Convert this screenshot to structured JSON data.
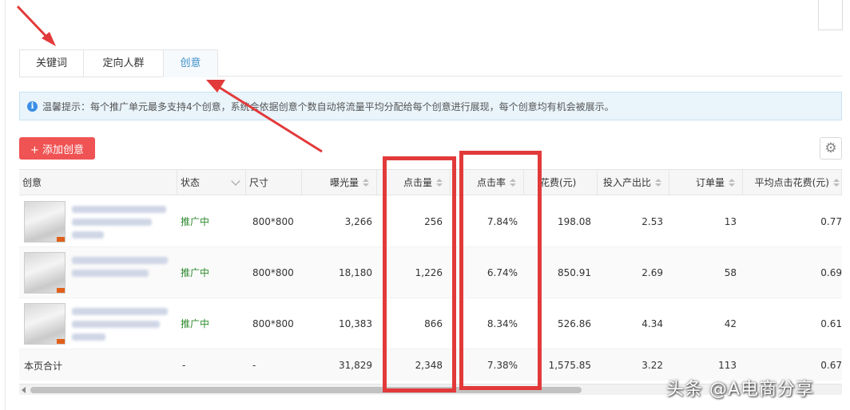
{
  "tabs": [
    {
      "label": "关键词"
    },
    {
      "label": "定向人群"
    },
    {
      "label": "创意"
    }
  ],
  "notice": {
    "icon": "info-icon",
    "text": "温馨提示：每个推广单元最多支持4个创意，系统会依据创意个数自动将流量平均分配给每个创意进行展现，每个创意均有机会被展示。"
  },
  "toolbar": {
    "add_label": "+ 添加创意",
    "settings_icon": "gear-icon"
  },
  "table": {
    "headers": [
      "创意",
      "状态",
      "尺寸",
      "曝光量",
      "点击量",
      "点击率",
      "花费(元)",
      "投入产出比",
      "订单量",
      "平均点击花费(元)"
    ],
    "rows": [
      {
        "status": "推广中",
        "size": "800*800",
        "impressions": "3,266",
        "clicks": "256",
        "ctr": "7.84%",
        "cost": "198.08",
        "roi": "2.53",
        "orders": "13",
        "avg_cpc": "0.77"
      },
      {
        "status": "推广中",
        "size": "800*800",
        "impressions": "18,180",
        "clicks": "1,226",
        "ctr": "6.74%",
        "cost": "850.91",
        "roi": "2.69",
        "orders": "58",
        "avg_cpc": "0.69"
      },
      {
        "status": "推广中",
        "size": "800*800",
        "impressions": "10,383",
        "clicks": "866",
        "ctr": "8.34%",
        "cost": "526.86",
        "roi": "4.34",
        "orders": "42",
        "avg_cpc": "0.61"
      }
    ],
    "summary": {
      "label": "本页合计",
      "status": "-",
      "size": "-",
      "impressions": "31,829",
      "clicks": "2,348",
      "ctr": "7.38%",
      "cost": "1,575.85",
      "roi": "3.22",
      "orders": "113",
      "avg_cpc": "0.67"
    }
  },
  "watermark": "头条 @A电商分享",
  "colors": {
    "accent": "#f05353",
    "highlight": "#e23a3a",
    "active_tab": "#3b8fc7",
    "status": "#2f8a2f"
  }
}
